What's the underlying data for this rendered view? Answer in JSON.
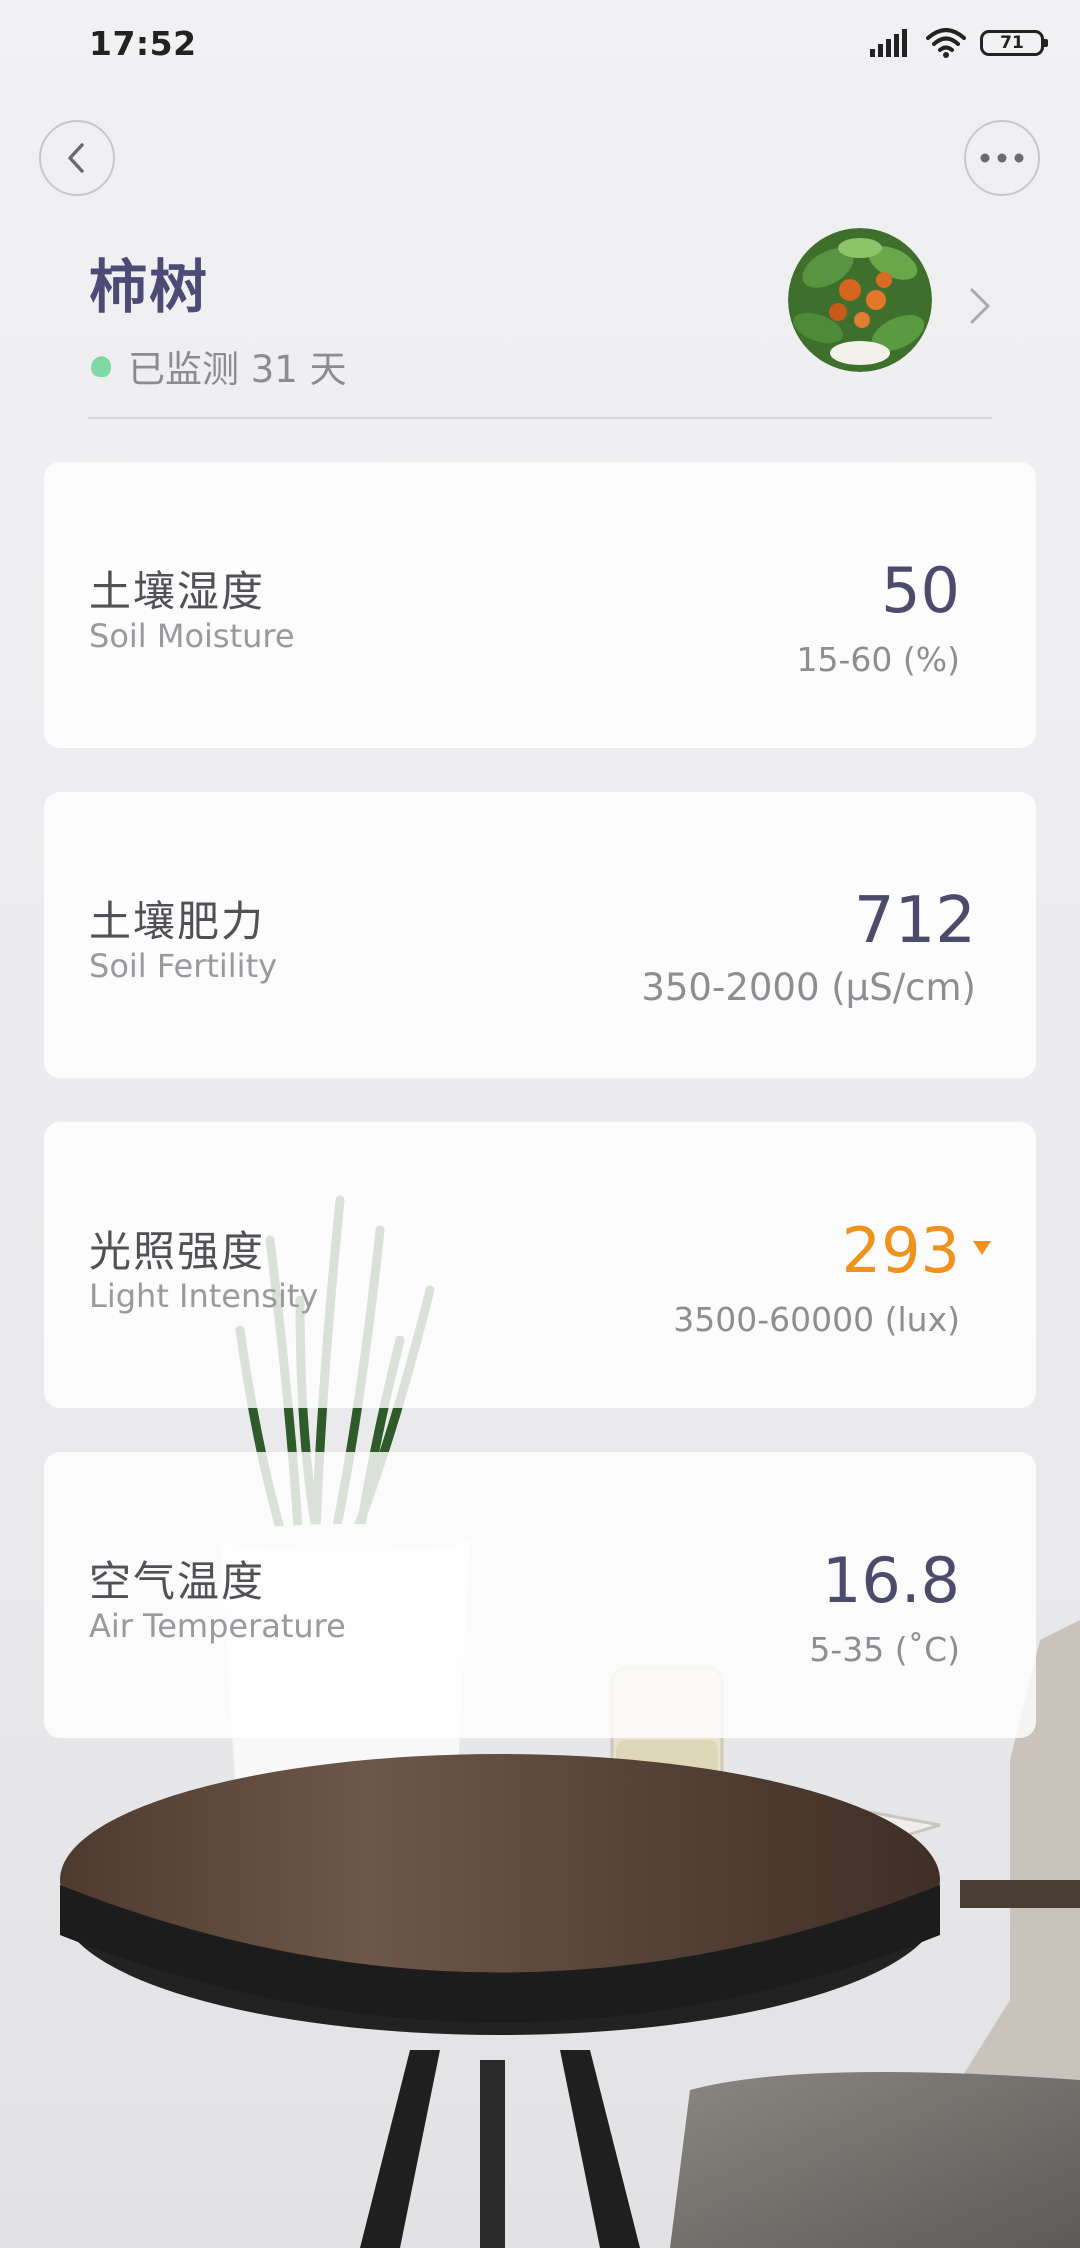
{
  "status_bar": {
    "time": "17:52",
    "battery": "71",
    "icons": [
      "signal-icon",
      "wifi-icon",
      "battery-icon"
    ]
  },
  "nav": {
    "back_icon": "chevron-left-icon",
    "more_icon": "more-dots-icon"
  },
  "header": {
    "plant_name": "柿树",
    "monitor_text": "已监测 31 天",
    "status_color": "#7fd9a4",
    "avatar": "plant-photo",
    "chevron_icon": "chevron-right-icon"
  },
  "metrics": [
    {
      "name_cn": "土壤湿度",
      "name_en": "Soil Moisture",
      "value": "50",
      "range": "15-60 (%)",
      "alert": false
    },
    {
      "name_cn": "土壤肥力",
      "name_en": "Soil Fertility",
      "value": "712",
      "range": "350-2000 (μS/cm)",
      "alert": false
    },
    {
      "name_cn": "光照强度",
      "name_en": "Light Intensity",
      "value": "293",
      "range": "3500-60000 (lux)",
      "alert": true,
      "alert_direction": "below"
    },
    {
      "name_cn": "空气温度",
      "name_en": "Air Temperature",
      "value": "16.8",
      "range": "5-35 (˚C)",
      "alert": false
    }
  ],
  "colors": {
    "title": "#4d4b75",
    "value": "#4d4b6b",
    "alert": "#f0921e"
  }
}
